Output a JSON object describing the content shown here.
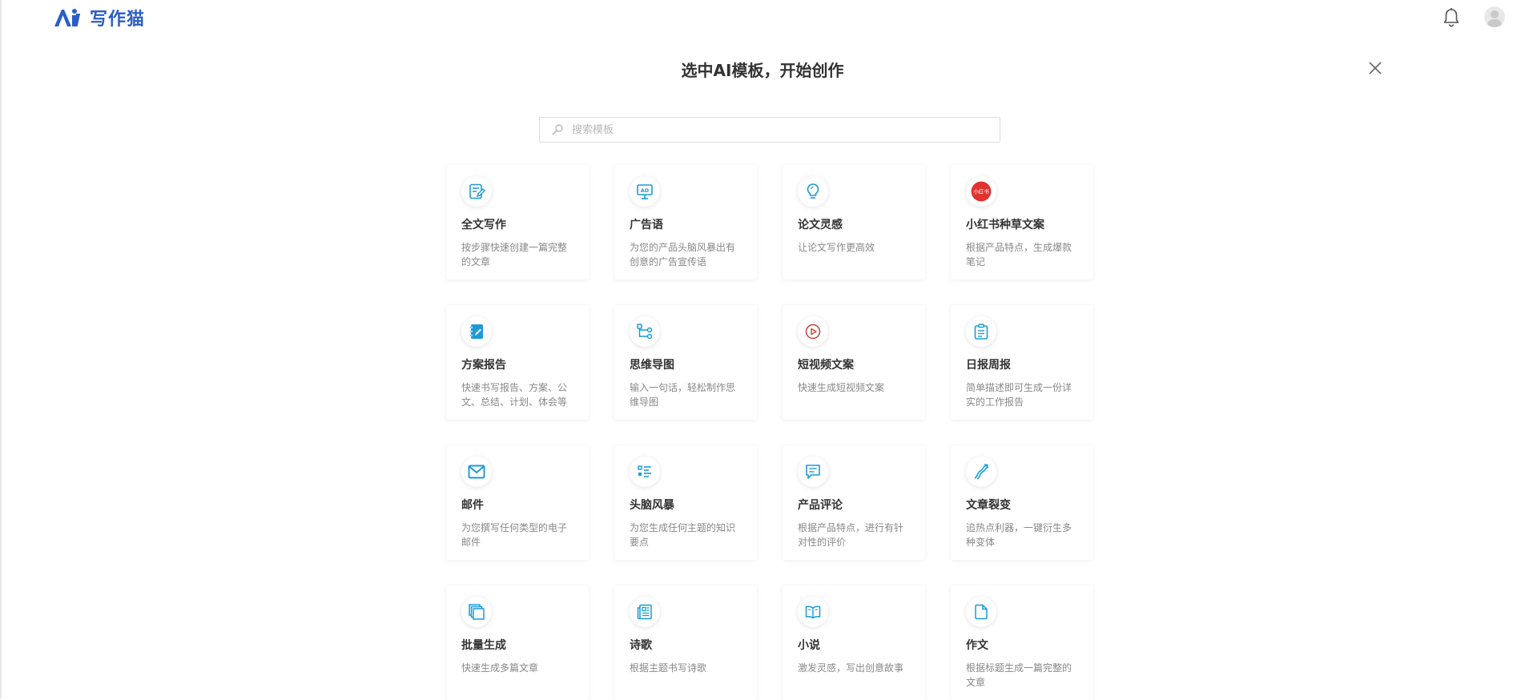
{
  "brand": {
    "logo_text": "写作猫",
    "accent_color": "#2a5ec7"
  },
  "header": {
    "bell_icon": "bell-icon",
    "avatar_icon": "user-avatar-icon"
  },
  "page": {
    "title": "选中AI模板，开始创作",
    "close_icon": "close-icon"
  },
  "search": {
    "placeholder": "搜索模板",
    "value": ""
  },
  "cards": [
    {
      "title": "全文写作",
      "desc": "按步骤快速创建一篇完整的文章",
      "icon": "edit-document-icon"
    },
    {
      "title": "广告语",
      "desc": "为您的产品头脑风暴出有创意的广告宣传语",
      "icon": "ad-billboard-icon"
    },
    {
      "title": "论文灵感",
      "desc": "让论文写作更高效",
      "icon": "lightbulb-icon"
    },
    {
      "title": "小红书种草文案",
      "desc": "根据产品特点，生成爆款笔记",
      "icon": "xiaohongshu-icon",
      "icon_text": "小红书"
    },
    {
      "title": "方案报告",
      "desc": "快速书写报告、方案、公文、总结、计划、体会等",
      "icon": "notebook-pen-icon"
    },
    {
      "title": "思维导图",
      "desc": "输入一句话，轻松制作思维导图",
      "icon": "mindmap-icon"
    },
    {
      "title": "短视频文案",
      "desc": "快速生成短视频文案",
      "icon": "play-circle-icon"
    },
    {
      "title": "日报周报",
      "desc": "简单描述即可生成一份详实的工作报告",
      "icon": "clipboard-icon"
    },
    {
      "title": "邮件",
      "desc": "为您撰写任何类型的电子邮件",
      "icon": "mail-icon"
    },
    {
      "title": "头脑风暴",
      "desc": "为您生成任何主题的知识要点",
      "icon": "list-icon"
    },
    {
      "title": "产品评论",
      "desc": "根据产品特点，进行有针对性的评价",
      "icon": "comment-icon"
    },
    {
      "title": "文章裂变",
      "desc": "追热点利器，一键衍生多种变体",
      "icon": "split-arrows-icon"
    },
    {
      "title": "批量生成",
      "desc": "快速生成多篇文章",
      "icon": "stacked-pages-icon"
    },
    {
      "title": "诗歌",
      "desc": "根据主题书写诗歌",
      "icon": "newspaper-icon"
    },
    {
      "title": "小说",
      "desc": "激发灵感，写出创意故事",
      "icon": "open-book-icon"
    },
    {
      "title": "作文",
      "desc": "根据标题生成一篇完整的文章",
      "icon": "file-icon"
    }
  ],
  "colors": {
    "icon_blue": "#1a9bd8",
    "xiaohongshu_red": "#e0322f",
    "video_red": "#c0443b"
  }
}
